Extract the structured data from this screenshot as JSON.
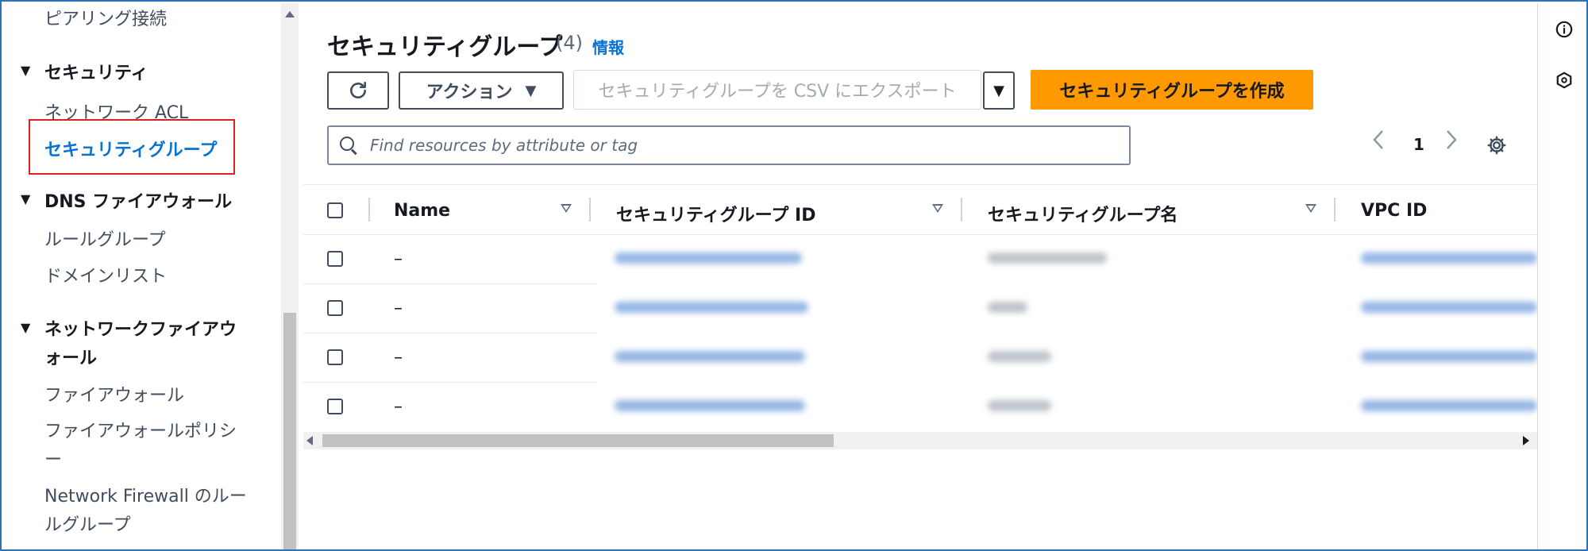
{
  "sidebar": {
    "items": [
      {
        "type": "item",
        "label": "ピアリング接続"
      },
      {
        "type": "section",
        "label": "セキュリティ"
      },
      {
        "type": "item",
        "label": "ネットワーク ACL"
      },
      {
        "type": "item",
        "label": "セキュリティグループ",
        "active": true
      },
      {
        "type": "section",
        "label": "DNS ファイアウォール"
      },
      {
        "type": "item",
        "label": "ルールグループ"
      },
      {
        "type": "item",
        "label": "ドメインリスト"
      },
      {
        "type": "section",
        "label": "ネットワークファイアウォール"
      },
      {
        "type": "item",
        "label": "ファイアウォール"
      },
      {
        "type": "item",
        "label": "ファイアウォールポリシー"
      },
      {
        "type": "item",
        "label": "Network Firewall のルールグループ"
      }
    ],
    "section_line1": {
      "s7": "ネットワークファイアウ"
    },
    "section_line2": {
      "s7": "ォール"
    },
    "item_line1": {
      "i9": "ファイアウォールポリシ",
      "i10": "Network Firewall のルー"
    },
    "item_line2": {
      "i9": "ー",
      "i10": "ルグループ"
    }
  },
  "header": {
    "title": "セキュリティグループ",
    "count": "(4)",
    "info_link": "情報"
  },
  "toolbar": {
    "refresh_icon": "refresh-icon",
    "actions_label": "アクション",
    "export_label": "セキュリティグループを CSV にエクスポート",
    "create_label": "セキュリティグループを作成"
  },
  "search": {
    "placeholder": "Find resources by attribute or tag",
    "value": ""
  },
  "pagination": {
    "current_page": "1"
  },
  "table": {
    "columns": [
      "Name",
      "セキュリティグループ ID",
      "セキュリティグループ名",
      "VPC ID"
    ],
    "rows": [
      {
        "name": "–"
      },
      {
        "name": "–"
      },
      {
        "name": "–"
      },
      {
        "name": "–"
      }
    ]
  },
  "colors": {
    "accent": "#0972d3",
    "primary_button": "#ff9900",
    "highlight_border": "#e02020",
    "frame_border": "#2e72b8"
  }
}
